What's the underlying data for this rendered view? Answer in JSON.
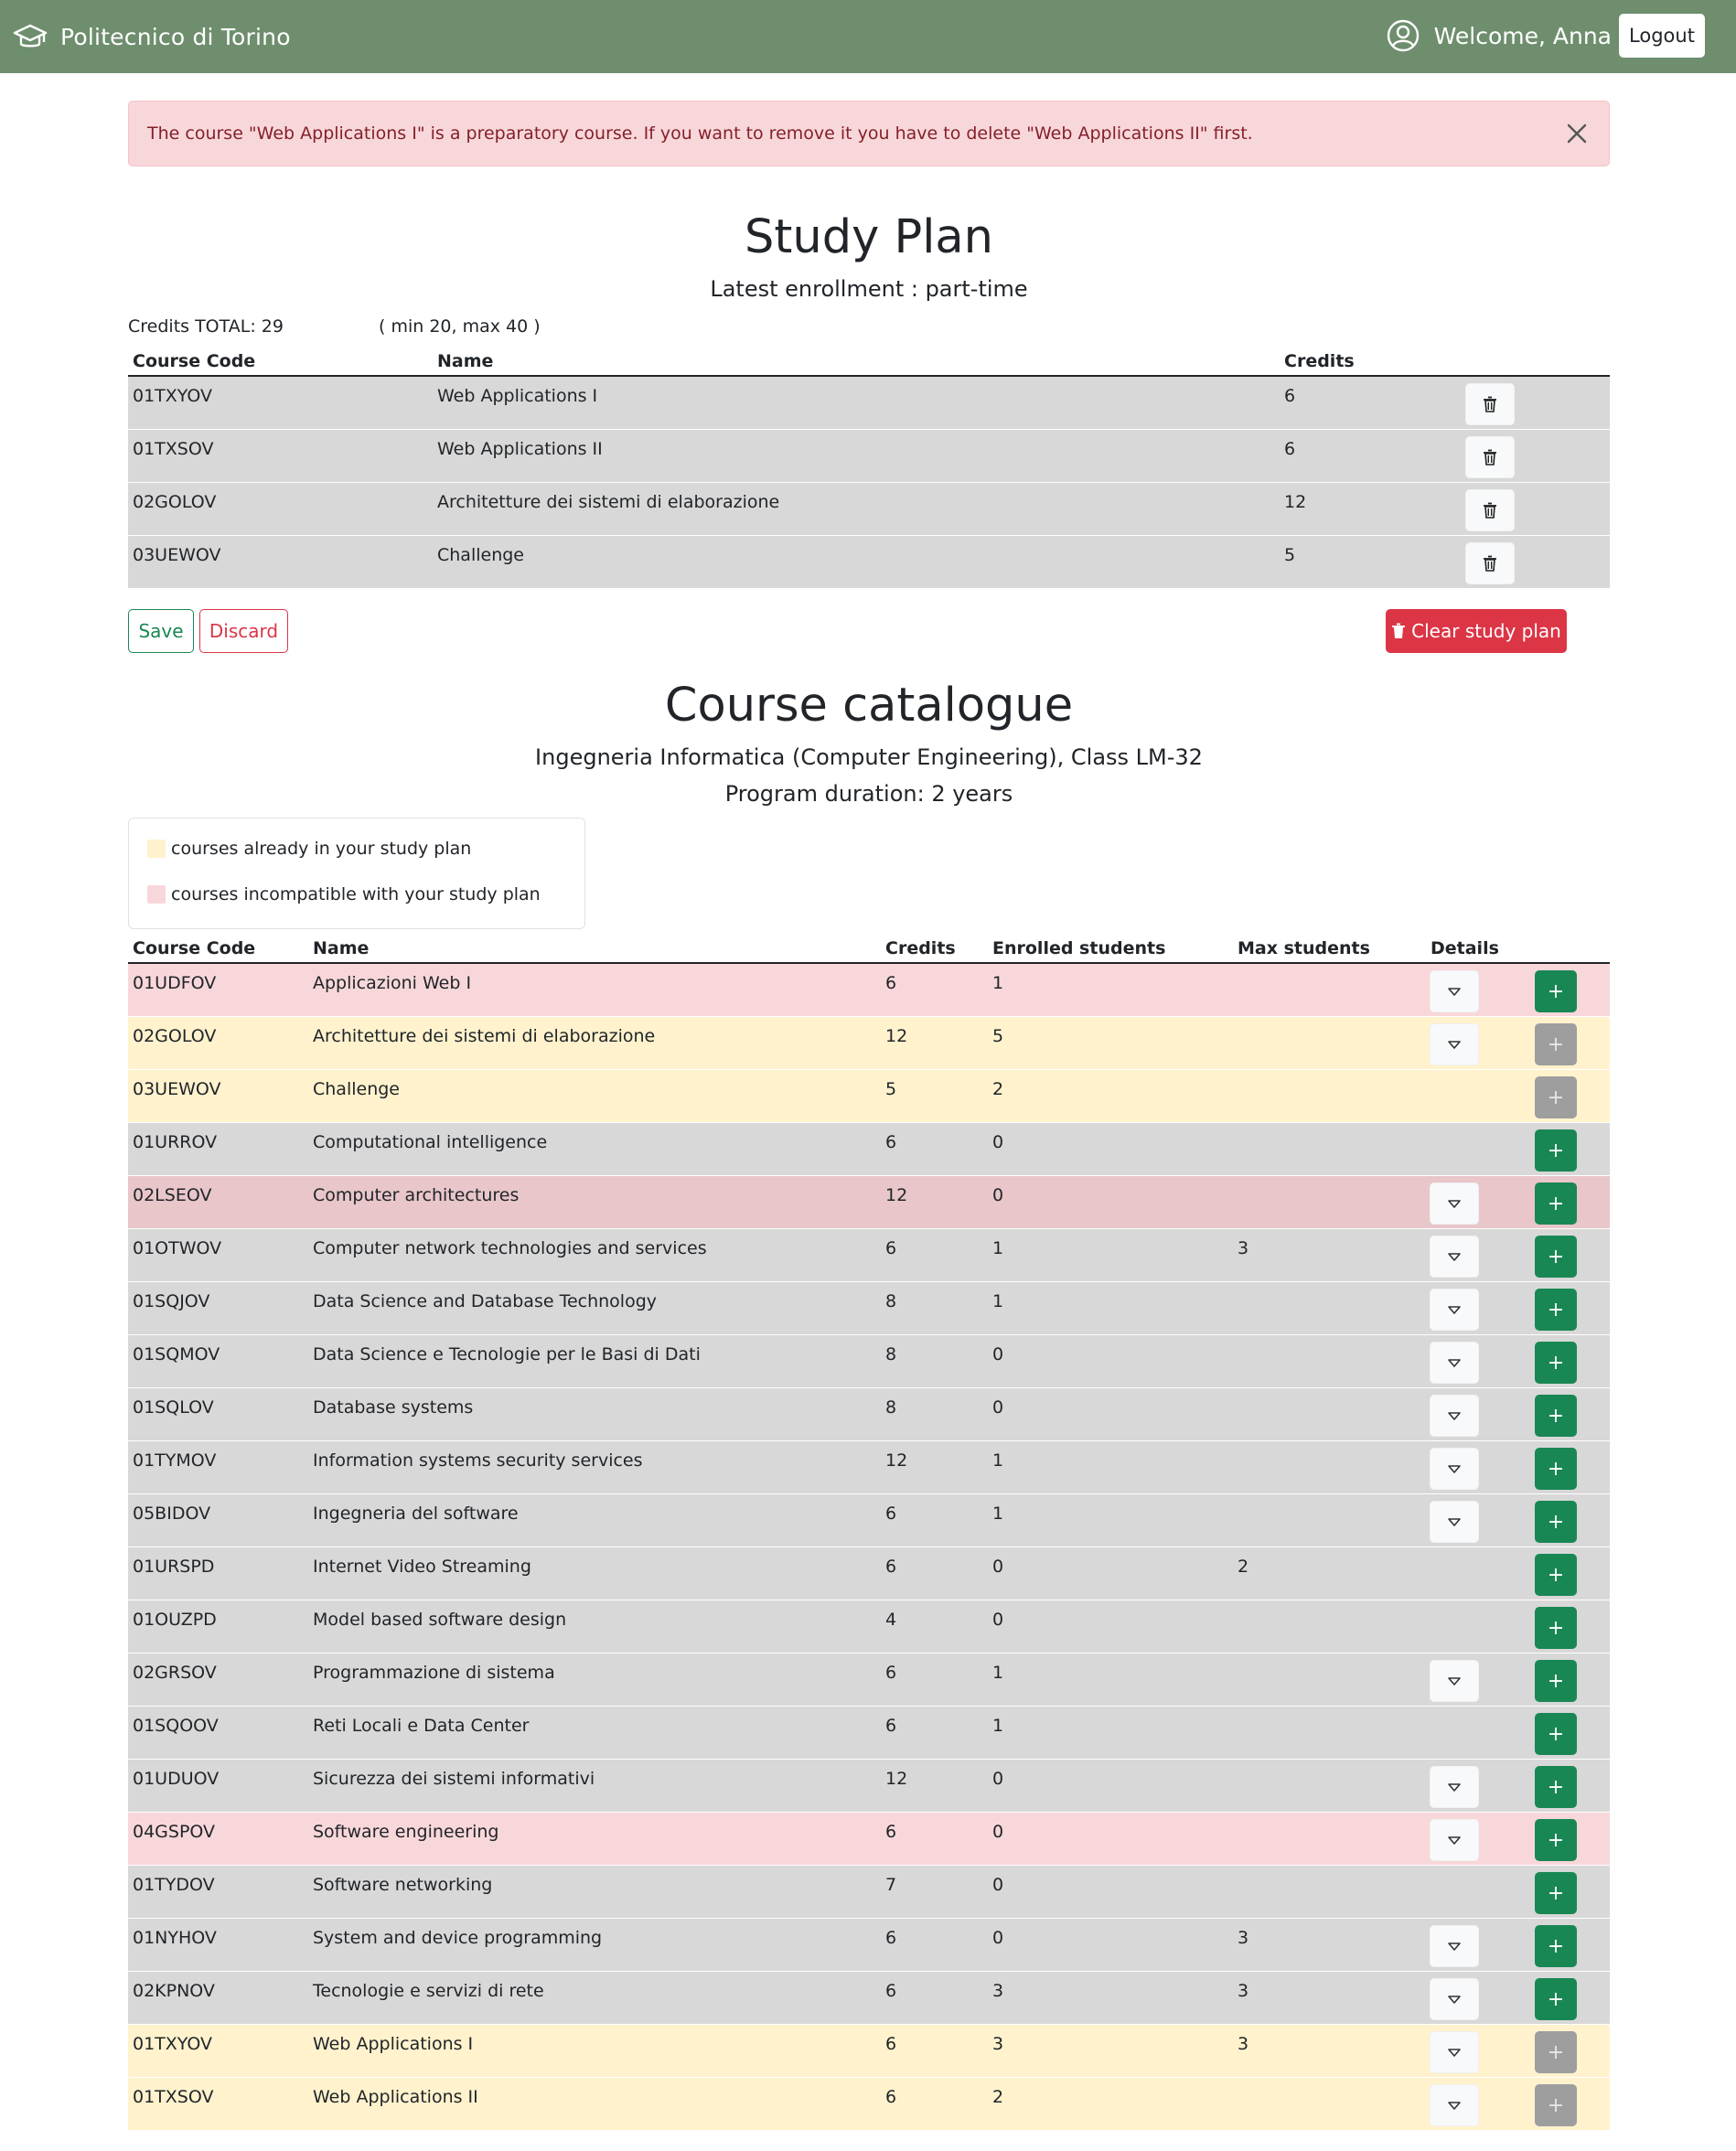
{
  "navbar": {
    "brand": "Politecnico di Torino",
    "brand_icon": "graduation-cap-icon",
    "welcome": "Welcome, Anna",
    "user_icon": "user-circle-icon",
    "logout_label": "Logout"
  },
  "alert": {
    "message": "The course \"Web Applications I\" is a preparatory course. If you want to remove it you have to delete \"Web Applications II\" first.",
    "close_icon": "close-icon"
  },
  "study_plan": {
    "title": "Study Plan",
    "subtitle": "Latest enrollment : part-time",
    "credits_total": "Credits TOTAL: 29",
    "credits_range": "( min 20, max 40 )",
    "columns": {
      "code": "Course Code",
      "name": "Name",
      "credits": "Credits"
    },
    "rows": [
      {
        "code": "01TXYOV",
        "name": "Web Applications I",
        "credits": "6"
      },
      {
        "code": "01TXSOV",
        "name": "Web Applications II",
        "credits": "6"
      },
      {
        "code": "02GOLOV",
        "name": "Architetture dei sistemi di elaborazione",
        "credits": "12"
      },
      {
        "code": "03UEWOV",
        "name": "Challenge",
        "credits": "5"
      }
    ],
    "save_label": "Save",
    "discard_label": "Discard",
    "clear_label": "Clear study plan"
  },
  "catalogue": {
    "title": "Course catalogue",
    "subtitle1": "Ingegneria Informatica (Computer Engineering), Class LM-32",
    "subtitle2": "Program duration: 2 years",
    "legend": {
      "in_plan": "courses already in your study plan",
      "incompatible": "courses incompatible with your study plan"
    },
    "colors": {
      "in_plan": "#fff2cd",
      "incompatible": "#f8d7da",
      "default": "#d8d8d8",
      "add": "#198754"
    },
    "columns": {
      "code": "Course Code",
      "name": "Name",
      "credits": "Credits",
      "enrolled": "Enrolled students",
      "max": "Max students",
      "details": "Details"
    },
    "add_label": "+",
    "rows": [
      {
        "code": "01UDFOV",
        "name": "Applicazioni Web I",
        "credits": "6",
        "enrolled": "1",
        "max": "",
        "state": "incompat",
        "details": true,
        "add_enabled": true
      },
      {
        "code": "02GOLOV",
        "name": "Architetture dei sistemi di elaborazione",
        "credits": "12",
        "enrolled": "5",
        "max": "",
        "state": "added",
        "details": true,
        "add_enabled": false
      },
      {
        "code": "03UEWOV",
        "name": "Challenge",
        "credits": "5",
        "enrolled": "2",
        "max": "",
        "state": "added",
        "details": false,
        "add_enabled": false
      },
      {
        "code": "01URROV",
        "name": "Computational intelligence",
        "credits": "6",
        "enrolled": "0",
        "max": "",
        "state": "default",
        "details": false,
        "add_enabled": true
      },
      {
        "code": "02LSEOV",
        "name": "Computer architectures",
        "credits": "12",
        "enrolled": "0",
        "max": "",
        "state": "incompat-dark",
        "details": true,
        "add_enabled": true
      },
      {
        "code": "01OTWOV",
        "name": "Computer network technologies and services",
        "credits": "6",
        "enrolled": "1",
        "max": "3",
        "state": "default",
        "details": true,
        "add_enabled": true
      },
      {
        "code": "01SQJOV",
        "name": "Data Science and Database Technology",
        "credits": "8",
        "enrolled": "1",
        "max": "",
        "state": "default",
        "details": true,
        "add_enabled": true
      },
      {
        "code": "01SQMOV",
        "name": "Data Science e Tecnologie per le Basi di Dati",
        "credits": "8",
        "enrolled": "0",
        "max": "",
        "state": "default",
        "details": true,
        "add_enabled": true
      },
      {
        "code": "01SQLOV",
        "name": "Database systems",
        "credits": "8",
        "enrolled": "0",
        "max": "",
        "state": "default",
        "details": true,
        "add_enabled": true
      },
      {
        "code": "01TYMOV",
        "name": "Information systems security services",
        "credits": "12",
        "enrolled": "1",
        "max": "",
        "state": "default",
        "details": true,
        "add_enabled": true
      },
      {
        "code": "05BIDOV",
        "name": "Ingegneria del software",
        "credits": "6",
        "enrolled": "1",
        "max": "",
        "state": "default",
        "details": true,
        "add_enabled": true
      },
      {
        "code": "01URSPD",
        "name": "Internet Video Streaming",
        "credits": "6",
        "enrolled": "0",
        "max": "2",
        "state": "default",
        "details": false,
        "add_enabled": true
      },
      {
        "code": "01OUZPD",
        "name": "Model based software design",
        "credits": "4",
        "enrolled": "0",
        "max": "",
        "state": "default",
        "details": false,
        "add_enabled": true
      },
      {
        "code": "02GRSOV",
        "name": "Programmazione di sistema",
        "credits": "6",
        "enrolled": "1",
        "max": "",
        "state": "default",
        "details": true,
        "add_enabled": true
      },
      {
        "code": "01SQOOV",
        "name": "Reti Locali e Data Center",
        "credits": "6",
        "enrolled": "1",
        "max": "",
        "state": "default",
        "details": false,
        "add_enabled": true
      },
      {
        "code": "01UDUOV",
        "name": "Sicurezza dei sistemi informativi",
        "credits": "12",
        "enrolled": "0",
        "max": "",
        "state": "default",
        "details": true,
        "add_enabled": true
      },
      {
        "code": "04GSPOV",
        "name": "Software engineering",
        "credits": "6",
        "enrolled": "0",
        "max": "",
        "state": "incompat",
        "details": true,
        "add_enabled": true
      },
      {
        "code": "01TYDOV",
        "name": "Software networking",
        "credits": "7",
        "enrolled": "0",
        "max": "",
        "state": "default",
        "details": false,
        "add_enabled": true
      },
      {
        "code": "01NYHOV",
        "name": "System and device programming",
        "credits": "6",
        "enrolled": "0",
        "max": "3",
        "state": "default",
        "details": true,
        "add_enabled": true
      },
      {
        "code": "02KPNOV",
        "name": "Tecnologie e servizi di rete",
        "credits": "6",
        "enrolled": "3",
        "max": "3",
        "state": "default",
        "details": true,
        "add_enabled": true
      },
      {
        "code": "01TXYOV",
        "name": "Web Applications I",
        "credits": "6",
        "enrolled": "3",
        "max": "3",
        "state": "added",
        "details": true,
        "add_enabled": false
      },
      {
        "code": "01TXSOV",
        "name": "Web Applications II",
        "credits": "6",
        "enrolled": "2",
        "max": "",
        "state": "added",
        "details": true,
        "add_enabled": false
      }
    ]
  }
}
